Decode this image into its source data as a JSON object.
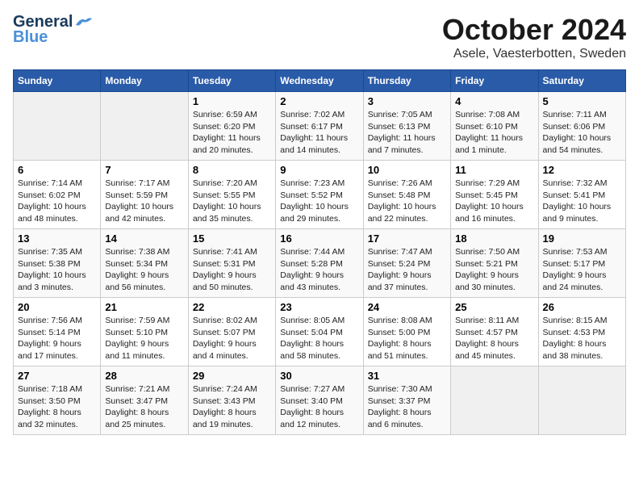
{
  "header": {
    "logo_general": "General",
    "logo_blue": "Blue",
    "month_title": "October 2024",
    "location": "Asele, Vaesterbotten, Sweden"
  },
  "weekdays": [
    "Sunday",
    "Monday",
    "Tuesday",
    "Wednesday",
    "Thursday",
    "Friday",
    "Saturday"
  ],
  "weeks": [
    [
      {
        "day": "",
        "info": ""
      },
      {
        "day": "",
        "info": ""
      },
      {
        "day": "1",
        "sunrise": "Sunrise: 6:59 AM",
        "sunset": "Sunset: 6:20 PM",
        "daylight": "Daylight: 11 hours and 20 minutes."
      },
      {
        "day": "2",
        "sunrise": "Sunrise: 7:02 AM",
        "sunset": "Sunset: 6:17 PM",
        "daylight": "Daylight: 11 hours and 14 minutes."
      },
      {
        "day": "3",
        "sunrise": "Sunrise: 7:05 AM",
        "sunset": "Sunset: 6:13 PM",
        "daylight": "Daylight: 11 hours and 7 minutes."
      },
      {
        "day": "4",
        "sunrise": "Sunrise: 7:08 AM",
        "sunset": "Sunset: 6:10 PM",
        "daylight": "Daylight: 11 hours and 1 minute."
      },
      {
        "day": "5",
        "sunrise": "Sunrise: 7:11 AM",
        "sunset": "Sunset: 6:06 PM",
        "daylight": "Daylight: 10 hours and 54 minutes."
      }
    ],
    [
      {
        "day": "6",
        "sunrise": "Sunrise: 7:14 AM",
        "sunset": "Sunset: 6:02 PM",
        "daylight": "Daylight: 10 hours and 48 minutes."
      },
      {
        "day": "7",
        "sunrise": "Sunrise: 7:17 AM",
        "sunset": "Sunset: 5:59 PM",
        "daylight": "Daylight: 10 hours and 42 minutes."
      },
      {
        "day": "8",
        "sunrise": "Sunrise: 7:20 AM",
        "sunset": "Sunset: 5:55 PM",
        "daylight": "Daylight: 10 hours and 35 minutes."
      },
      {
        "day": "9",
        "sunrise": "Sunrise: 7:23 AM",
        "sunset": "Sunset: 5:52 PM",
        "daylight": "Daylight: 10 hours and 29 minutes."
      },
      {
        "day": "10",
        "sunrise": "Sunrise: 7:26 AM",
        "sunset": "Sunset: 5:48 PM",
        "daylight": "Daylight: 10 hours and 22 minutes."
      },
      {
        "day": "11",
        "sunrise": "Sunrise: 7:29 AM",
        "sunset": "Sunset: 5:45 PM",
        "daylight": "Daylight: 10 hours and 16 minutes."
      },
      {
        "day": "12",
        "sunrise": "Sunrise: 7:32 AM",
        "sunset": "Sunset: 5:41 PM",
        "daylight": "Daylight: 10 hours and 9 minutes."
      }
    ],
    [
      {
        "day": "13",
        "sunrise": "Sunrise: 7:35 AM",
        "sunset": "Sunset: 5:38 PM",
        "daylight": "Daylight: 10 hours and 3 minutes."
      },
      {
        "day": "14",
        "sunrise": "Sunrise: 7:38 AM",
        "sunset": "Sunset: 5:34 PM",
        "daylight": "Daylight: 9 hours and 56 minutes."
      },
      {
        "day": "15",
        "sunrise": "Sunrise: 7:41 AM",
        "sunset": "Sunset: 5:31 PM",
        "daylight": "Daylight: 9 hours and 50 minutes."
      },
      {
        "day": "16",
        "sunrise": "Sunrise: 7:44 AM",
        "sunset": "Sunset: 5:28 PM",
        "daylight": "Daylight: 9 hours and 43 minutes."
      },
      {
        "day": "17",
        "sunrise": "Sunrise: 7:47 AM",
        "sunset": "Sunset: 5:24 PM",
        "daylight": "Daylight: 9 hours and 37 minutes."
      },
      {
        "day": "18",
        "sunrise": "Sunrise: 7:50 AM",
        "sunset": "Sunset: 5:21 PM",
        "daylight": "Daylight: 9 hours and 30 minutes."
      },
      {
        "day": "19",
        "sunrise": "Sunrise: 7:53 AM",
        "sunset": "Sunset: 5:17 PM",
        "daylight": "Daylight: 9 hours and 24 minutes."
      }
    ],
    [
      {
        "day": "20",
        "sunrise": "Sunrise: 7:56 AM",
        "sunset": "Sunset: 5:14 PM",
        "daylight": "Daylight: 9 hours and 17 minutes."
      },
      {
        "day": "21",
        "sunrise": "Sunrise: 7:59 AM",
        "sunset": "Sunset: 5:10 PM",
        "daylight": "Daylight: 9 hours and 11 minutes."
      },
      {
        "day": "22",
        "sunrise": "Sunrise: 8:02 AM",
        "sunset": "Sunset: 5:07 PM",
        "daylight": "Daylight: 9 hours and 4 minutes."
      },
      {
        "day": "23",
        "sunrise": "Sunrise: 8:05 AM",
        "sunset": "Sunset: 5:04 PM",
        "daylight": "Daylight: 8 hours and 58 minutes."
      },
      {
        "day": "24",
        "sunrise": "Sunrise: 8:08 AM",
        "sunset": "Sunset: 5:00 PM",
        "daylight": "Daylight: 8 hours and 51 minutes."
      },
      {
        "day": "25",
        "sunrise": "Sunrise: 8:11 AM",
        "sunset": "Sunset: 4:57 PM",
        "daylight": "Daylight: 8 hours and 45 minutes."
      },
      {
        "day": "26",
        "sunrise": "Sunrise: 8:15 AM",
        "sunset": "Sunset: 4:53 PM",
        "daylight": "Daylight: 8 hours and 38 minutes."
      }
    ],
    [
      {
        "day": "27",
        "sunrise": "Sunrise: 7:18 AM",
        "sunset": "Sunset: 3:50 PM",
        "daylight": "Daylight: 8 hours and 32 minutes."
      },
      {
        "day": "28",
        "sunrise": "Sunrise: 7:21 AM",
        "sunset": "Sunset: 3:47 PM",
        "daylight": "Daylight: 8 hours and 25 minutes."
      },
      {
        "day": "29",
        "sunrise": "Sunrise: 7:24 AM",
        "sunset": "Sunset: 3:43 PM",
        "daylight": "Daylight: 8 hours and 19 minutes."
      },
      {
        "day": "30",
        "sunrise": "Sunrise: 7:27 AM",
        "sunset": "Sunset: 3:40 PM",
        "daylight": "Daylight: 8 hours and 12 minutes."
      },
      {
        "day": "31",
        "sunrise": "Sunrise: 7:30 AM",
        "sunset": "Sunset: 3:37 PM",
        "daylight": "Daylight: 8 hours and 6 minutes."
      },
      {
        "day": "",
        "info": ""
      },
      {
        "day": "",
        "info": ""
      }
    ]
  ]
}
